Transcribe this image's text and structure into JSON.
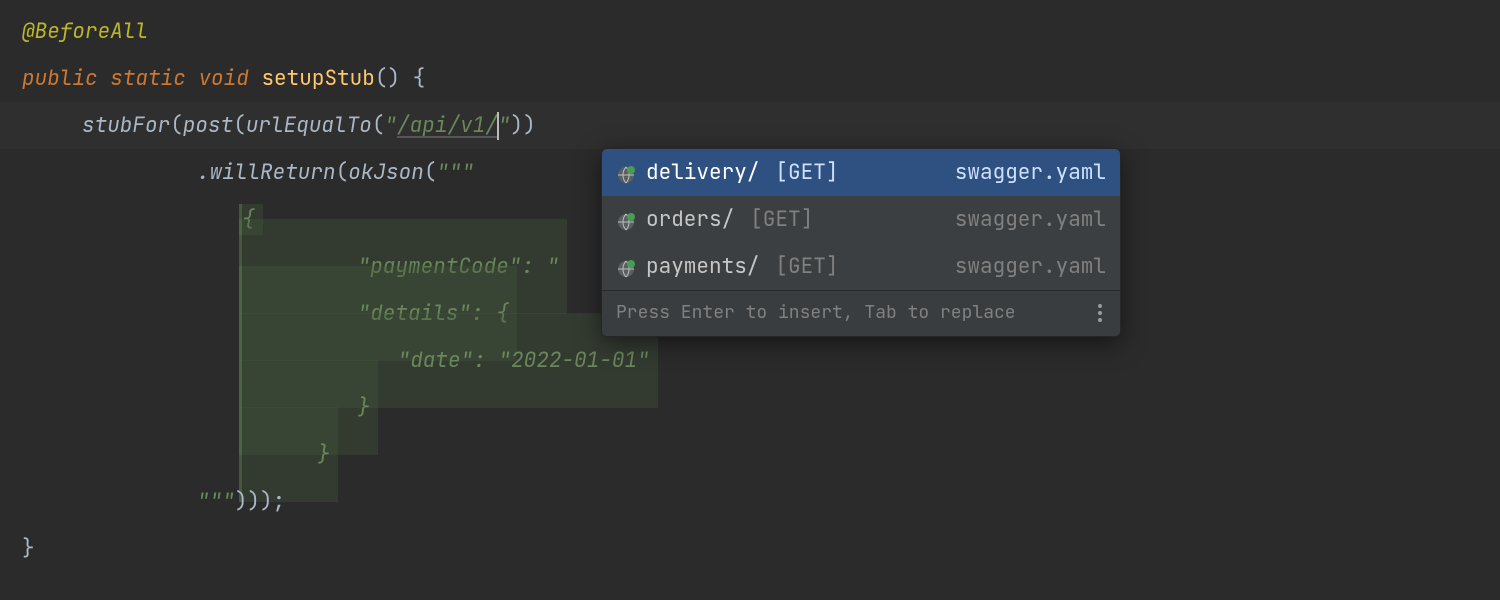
{
  "code": {
    "annotation": "@BeforeAll",
    "kw_public": "public",
    "kw_static": "static",
    "kw_void": "void",
    "method_name": "setupStub",
    "open_paren": "()",
    "space_brace": " {",
    "stubFor": "stubFor",
    "post": "post",
    "urlEqualTo": "urlEqualTo",
    "url_str_open": "\"",
    "url_str_val": "/api/v1/",
    "url_str_close": "\"",
    "willReturn": ".willReturn",
    "okJson": "okJson",
    "triple_open": "\"\"\"",
    "triple_close": "\"\"\"",
    "close_tail": ")));",
    "json_brace_open": "{",
    "json_brace_close": "}",
    "json_key_paymentCode": "\"paymentCode\"",
    "json_colon": ": ",
    "json_val_paymentCode_partial": "\"",
    "json_key_details": "\"details\"",
    "json_key_date": "\"date\"",
    "json_val_date": "\"2022-01-01\"",
    "close_brace": "}"
  },
  "popup": {
    "items": [
      {
        "name": "delivery/",
        "method": "[GET]",
        "src": "swagger.yaml",
        "selected": true
      },
      {
        "name": "orders/",
        "method": "[GET]",
        "src": "swagger.yaml",
        "selected": false
      },
      {
        "name": "payments/",
        "method": "[GET]",
        "src": "swagger.yaml",
        "selected": false
      }
    ],
    "hint": "Press Enter to insert, Tab to replace"
  }
}
